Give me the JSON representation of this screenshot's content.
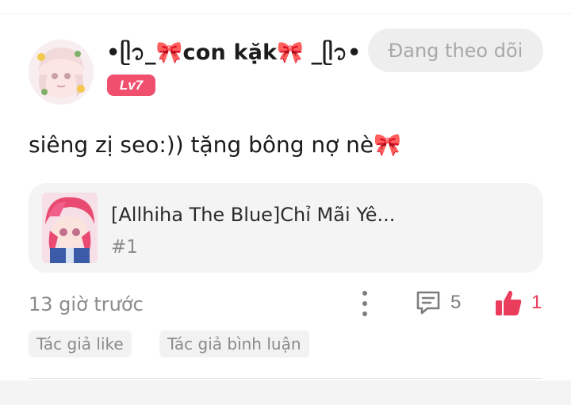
{
  "post": {
    "author": {
      "username": "•ᥫ᭡_🎀con kặk🎀 _ᥫ᭡•",
      "level": "Lv7"
    },
    "follow_button": {
      "label": "Đang theo dõi"
    },
    "content": "siêng zị seo:)) tặng bông nợ nè🎀",
    "story": {
      "title": "[Allhiha The Blue]Chỉ Mãi Yê...",
      "chapter": "#1"
    },
    "timestamp": "13 giờ trước",
    "comment_count": "5",
    "like_count": "1",
    "tags": {
      "author_like": "Tác giả like",
      "author_comment": "Tác giả bình luận"
    }
  },
  "icons": {
    "more": "more-vertical-icon",
    "comment": "comment-icon",
    "like": "thumbs-up-icon"
  },
  "colors": {
    "accent": "#ea3d5c",
    "badge": "#f0506e",
    "follow_bg": "#eeeeee",
    "card_bg": "#f4f4f4"
  }
}
